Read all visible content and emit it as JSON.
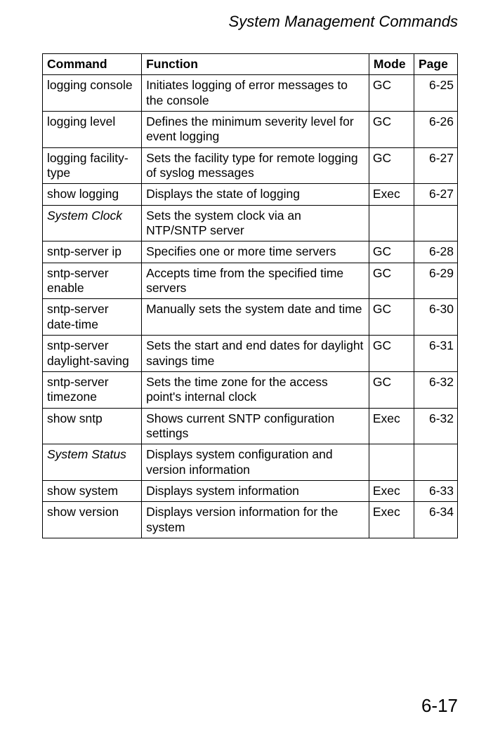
{
  "header": {
    "title": "System Management Commands"
  },
  "table": {
    "headers": {
      "command": "Command",
      "function": "Function",
      "mode": "Mode",
      "page": "Page"
    },
    "rows": [
      {
        "command": "logging console",
        "function": "Initiates logging of error messages to the console",
        "mode": "GC",
        "page": "6-25",
        "italic": false
      },
      {
        "command": "logging level",
        "function": "Defines the minimum severity level for event logging",
        "mode": "GC",
        "page": "6-26",
        "italic": false
      },
      {
        "command": "logging facility-type",
        "function": "Sets the facility type for remote logging of syslog messages",
        "mode": "GC",
        "page": "6-27",
        "italic": false
      },
      {
        "command": "show logging",
        "function": "Displays the state of logging",
        "mode": "Exec",
        "page": "6-27",
        "italic": false
      },
      {
        "command": "System Clock",
        "function": "Sets the system clock via an NTP/SNTP server",
        "mode": "",
        "page": "",
        "italic": true
      },
      {
        "command": "sntp-server ip",
        "function": "Specifies one or more time servers",
        "mode": "GC",
        "page": "6-28",
        "italic": false
      },
      {
        "command": "sntp-server enable",
        "function": "Accepts time from the specified time servers",
        "mode": "GC",
        "page": "6-29",
        "italic": false
      },
      {
        "command": "sntp-server date-time",
        "function": "Manually sets the system date and time",
        "mode": "GC",
        "page": "6-30",
        "italic": false
      },
      {
        "command": "sntp-server daylight-saving",
        "function": "Sets the start and end dates for daylight savings time",
        "mode": "GC",
        "page": "6-31",
        "italic": false
      },
      {
        "command": "sntp-server timezone",
        "function": "Sets the time zone for the access point's internal clock",
        "mode": "GC",
        "page": "6-32",
        "italic": false
      },
      {
        "command": "show sntp",
        "function": "Shows current SNTP configuration settings",
        "mode": "Exec",
        "page": "6-32",
        "italic": false
      },
      {
        "command": "System Status",
        "function": "Displays system configuration and version information",
        "mode": "",
        "page": "",
        "italic": true
      },
      {
        "command": "show system",
        "function": "Displays system information",
        "mode": "Exec",
        "page": "6-33",
        "italic": false
      },
      {
        "command": "show version",
        "function": "Displays version information for the system",
        "mode": "Exec",
        "page": "6-34",
        "italic": false
      }
    ]
  },
  "footer": {
    "page_number": "6-17"
  }
}
